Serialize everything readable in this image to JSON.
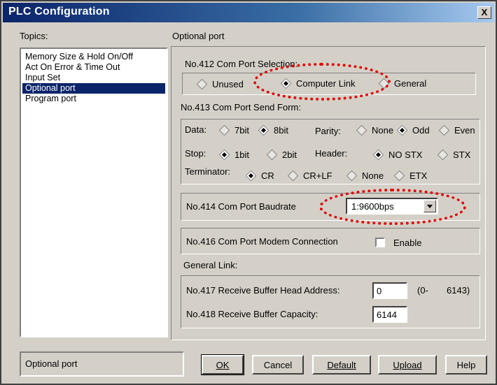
{
  "window": {
    "title": "PLC Configuration",
    "close_label": "X"
  },
  "topics": {
    "label": "Topics:",
    "items": [
      "Memory Size & Hold On/Off",
      "Act On Error & Time Out",
      "Input Set",
      "Optional port",
      "Program port"
    ],
    "selected": "Optional port"
  },
  "panel": {
    "title": "Optional port",
    "com_port_selection": {
      "label": "No.412 Com Port Selection:",
      "options": [
        "Unused",
        "Computer Link",
        "General"
      ],
      "selected": "Computer Link"
    },
    "com_port_send_form": {
      "label": "No.413 Com Port Send Form:",
      "data_label": "Data:",
      "data_options": [
        "7bit",
        "8bit"
      ],
      "data_selected": "8bit",
      "parity_label": "Parity:",
      "parity_options": [
        "None",
        "Odd",
        "Even"
      ],
      "parity_selected": "Odd",
      "stop_label": "Stop:",
      "stop_options": [
        "1bit",
        "2bit"
      ],
      "stop_selected": "1bit",
      "header_label": "Header:",
      "header_options": [
        "NO STX",
        "STX"
      ],
      "header_selected": "NO STX",
      "terminator_label": "Terminator:",
      "terminator_options": [
        "CR",
        "CR+LF",
        "None",
        "ETX"
      ],
      "terminator_selected": "CR"
    },
    "baudrate": {
      "label": "No.414 Com Port Baudrate",
      "value": "1:9600bps"
    },
    "modem": {
      "label": "No.416 Com Port Modem Connection",
      "checkbox_label": "Enable",
      "checked": false
    },
    "general_link": {
      "label": "General Link:",
      "head_address_label": "No.417 Receive Buffer Head Address:",
      "head_address_value": "0",
      "range_open": "(0-",
      "range_close": "6143)",
      "capacity_label": "No.418 Receive Buffer Capacity:",
      "capacity_value": "6144"
    }
  },
  "status": {
    "text": "Optional port"
  },
  "buttons": {
    "ok": "OK",
    "cancel": "Cancel",
    "default": "Default",
    "upload": "Upload",
    "help": "Help"
  },
  "colors": {
    "title_bar": "#0a246a",
    "face": "#d4d0c8",
    "selection": "#0a246a",
    "annotation": "#e00000"
  }
}
